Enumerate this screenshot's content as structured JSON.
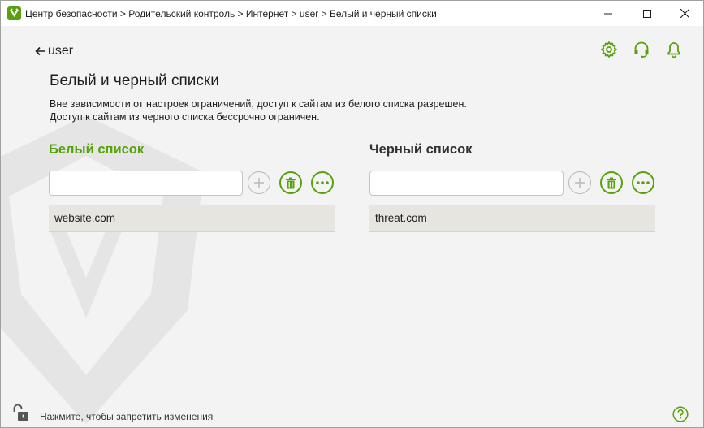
{
  "window": {
    "title": "Центр безопасности > Родительский контроль > Интернет > user > Белый и черный списки"
  },
  "nav": {
    "back_label": "user"
  },
  "page": {
    "title": "Белый и черный списки",
    "description_line1": "Вне зависимости от настроек ограничений, доступ к сайтам из белого списка разрешен.",
    "description_line2": "Доступ к сайтам из черного списка бессрочно ограничен."
  },
  "whitelist": {
    "title": "Белый список",
    "input_value": "",
    "items": [
      "website.com"
    ]
  },
  "blacklist": {
    "title": "Черный список",
    "input_value": "",
    "items": [
      "threat.com"
    ]
  },
  "footer": {
    "lock_text": "Нажмите, чтобы запретить изменения"
  },
  "colors": {
    "accent": "#58a10e",
    "list_row": "#e7e5df"
  },
  "icons": [
    "app-logo-icon",
    "back-arrow-icon",
    "settings-gear-icon",
    "support-headset-icon",
    "notification-bell-icon",
    "add-icon",
    "trash-icon",
    "more-icon",
    "unlock-icon",
    "help-icon"
  ]
}
